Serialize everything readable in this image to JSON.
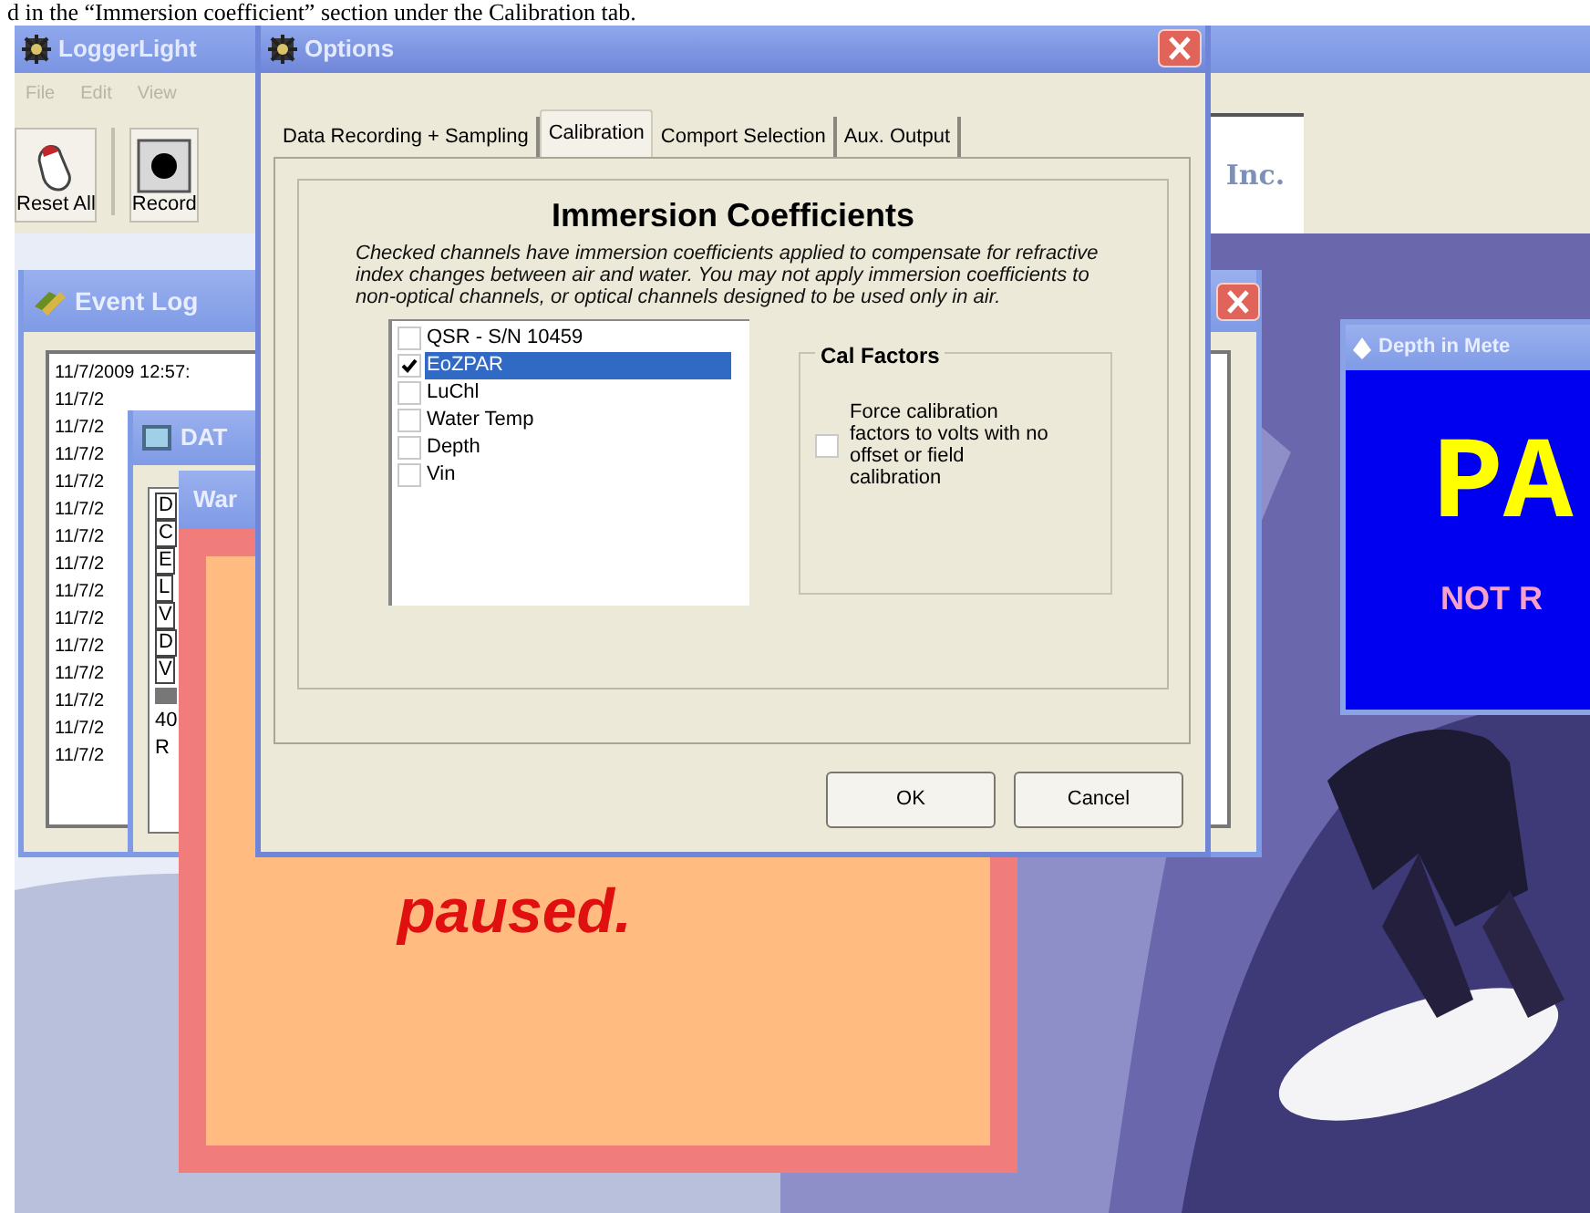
{
  "caption": "d in the “Immersion coefficient” section under the Calibration tab.",
  "main_window": {
    "title": "LoggerLight",
    "menu": [
      "File",
      "Edit",
      "View"
    ],
    "toolbar": [
      {
        "label": "Reset All",
        "kind": "reset"
      },
      {
        "label": "Record",
        "kind": "record"
      }
    ],
    "logo_text": "Inc."
  },
  "event_log": {
    "title": "Event Log",
    "lines": [
      "11/7/2009 12:57:",
      "11/7/2",
      "11/7/2",
      "11/7/2",
      "11/7/2",
      "11/7/2",
      "11/7/2",
      "11/7/2",
      "11/7/2",
      "11/7/2",
      "11/7/2",
      "11/7/2",
      "11/7/2",
      "11/7/2",
      "11/7/2"
    ]
  },
  "data_window": {
    "title": "DAT",
    "items": [
      "D",
      "C",
      "E",
      "L",
      "V",
      "D",
      "V"
    ],
    "footer": [
      "40",
      "R"
    ]
  },
  "warning_window": {
    "title": "War",
    "message": "paused."
  },
  "options": {
    "title": "Options",
    "tabs": [
      {
        "label": "Data Recording + Sampling",
        "selected": false
      },
      {
        "label": "Calibration",
        "selected": true
      },
      {
        "label": "Comport Selection",
        "selected": false
      },
      {
        "label": "Aux. Output",
        "selected": false
      }
    ],
    "heading": "Immersion Coefficients",
    "description": "Checked channels have immersion coefficients applied to compensate for refractive index changes between air and water. You may not apply immersion coefficients to non-optical channels, or optical channels designed to be used only in air.",
    "channels": [
      {
        "name": "QSR - S/N 10459",
        "checked": false,
        "selected": false
      },
      {
        "name": "EoZPAR",
        "checked": true,
        "selected": true
      },
      {
        "name": "LuChl",
        "checked": false,
        "selected": false
      },
      {
        "name": "Water Temp",
        "checked": false,
        "selected": false
      },
      {
        "name": "Depth",
        "checked": false,
        "selected": false
      },
      {
        "name": "Vin",
        "checked": false,
        "selected": false
      }
    ],
    "cal_factors": {
      "title": "Cal Factors",
      "label": "Force calibration factors to volts with no offset or field calibration",
      "checked": false
    },
    "buttons": [
      "OK",
      "Cancel"
    ]
  },
  "depth_window": {
    "title": "Depth in Mete",
    "value": "PA",
    "status": "NOT R"
  }
}
